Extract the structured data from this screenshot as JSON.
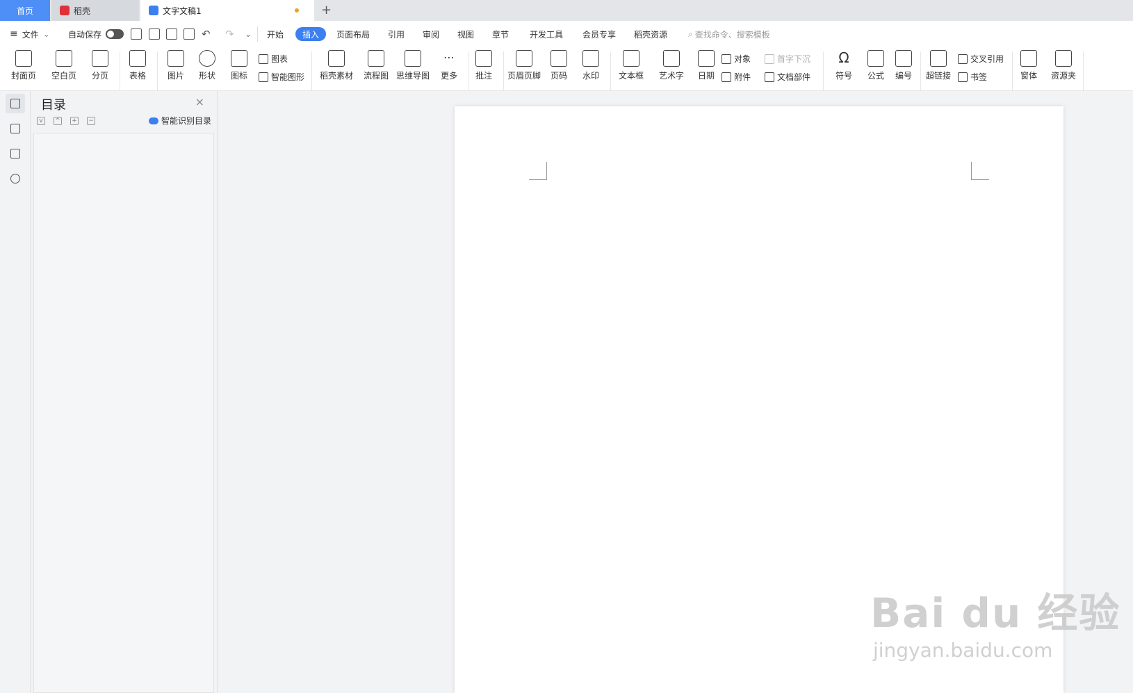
{
  "tabs": {
    "home": "首页",
    "daoke": "稻壳",
    "doc": "文字文稿1",
    "add": "+"
  },
  "menubar": {
    "file": "文件",
    "autosave": "自动保存",
    "tabs": [
      "开始",
      "插入",
      "页面布局",
      "引用",
      "审阅",
      "视图",
      "章节",
      "开发工具",
      "会员专享",
      "稻壳资源"
    ],
    "active_tab": "插入",
    "search_placeholder": "查找命令、搜索模板"
  },
  "ribbon": {
    "cover": "封面页",
    "blank": "空白页",
    "pagebreak": "分页",
    "table": "表格",
    "picture": "图片",
    "shape": "形状",
    "icon": "图标",
    "chart": "图表",
    "smartart": "智能图形",
    "daoke_material": "稻壳素材",
    "flowchart": "流程图",
    "mindmap": "思维导图",
    "more": "更多",
    "comment": "批注",
    "header_footer": "页眉页脚",
    "page_number": "页码",
    "watermark": "水印",
    "textbox": "文本框",
    "wordart": "艺术字",
    "date": "日期",
    "object": "对象",
    "attachment": "附件",
    "dropcap": "首字下沉",
    "docparts": "文档部件",
    "symbol": "符号",
    "formula": "公式",
    "numbering": "编号",
    "hyperlink": "超链接",
    "crossref": "交叉引用",
    "bookmark": "书签",
    "window": "窗体",
    "resources": "资源夹"
  },
  "toc": {
    "title": "目录",
    "smart_label": "智能识别目录",
    "close": "×",
    "expand_all": "v",
    "collapse_all": "^",
    "add": "+",
    "remove": "−"
  },
  "watermark": {
    "big": "Bai du 经验",
    "small": "jingyan.baidu.com"
  },
  "colors": {
    "accent": "#3b7ff0",
    "home_tab": "#4d8ef7"
  }
}
